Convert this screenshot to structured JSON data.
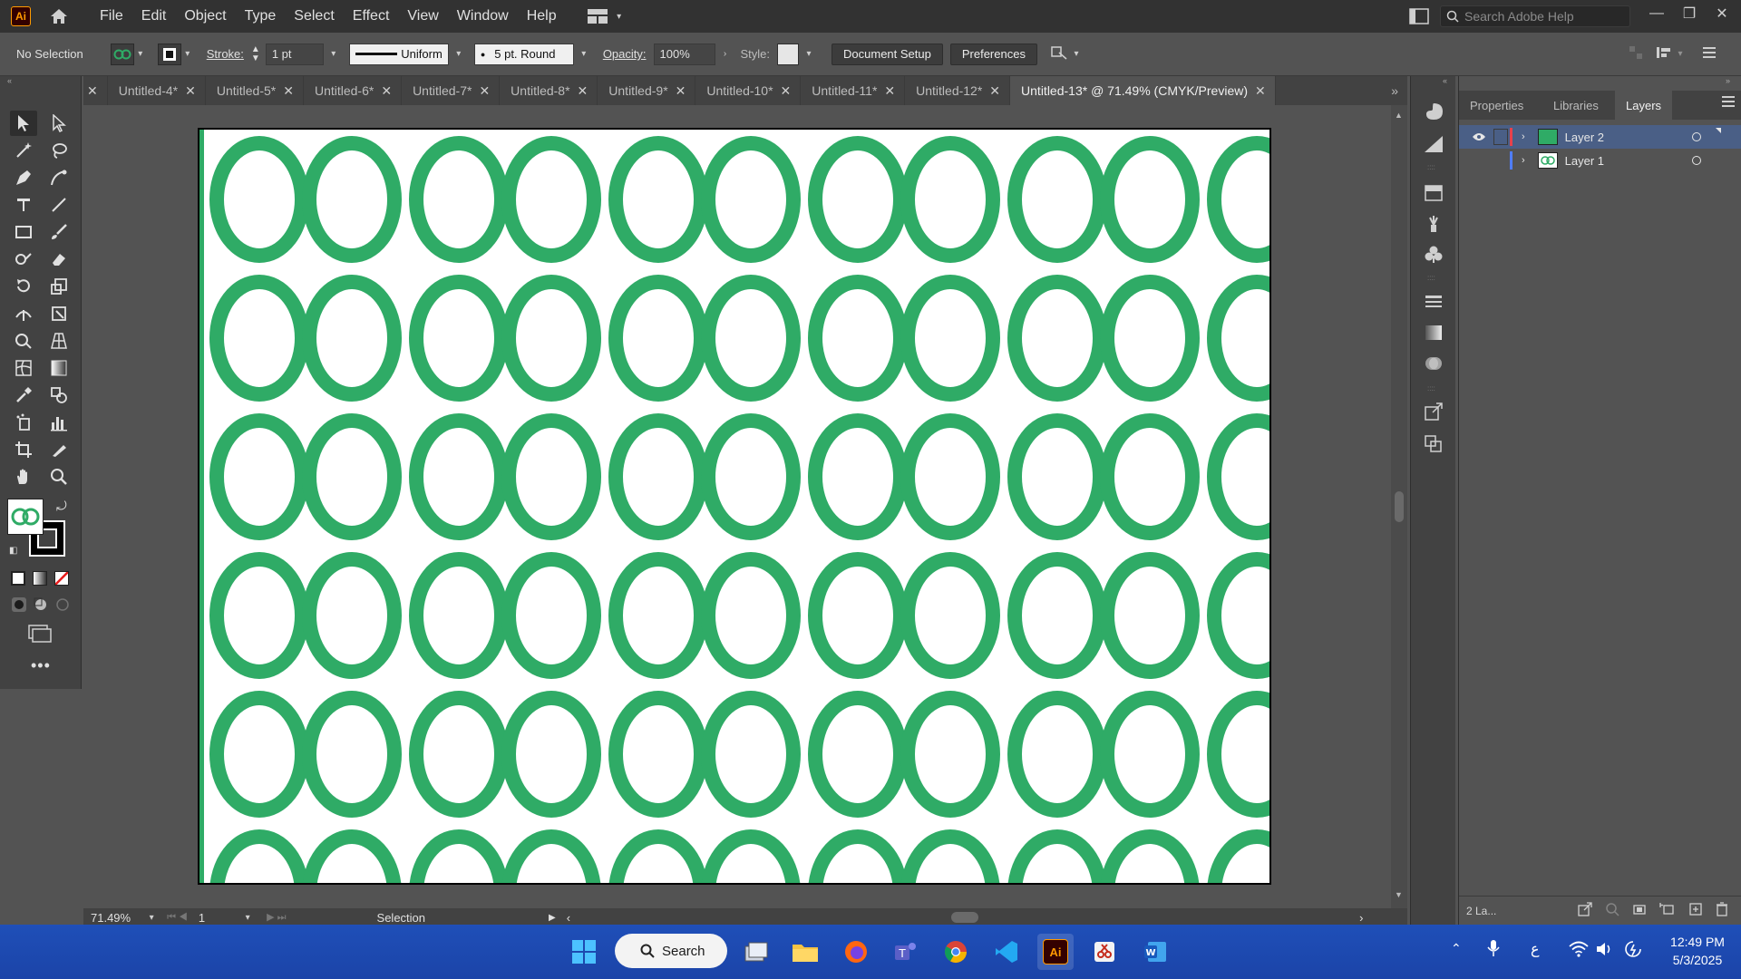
{
  "app": {
    "logo_text": "Ai",
    "menu": [
      "File",
      "Edit",
      "Object",
      "Type",
      "Select",
      "Effect",
      "View",
      "Window",
      "Help"
    ],
    "search_placeholder": "Search Adobe Help"
  },
  "control_bar": {
    "selection_label": "No Selection",
    "stroke_label": "Stroke:",
    "stroke_value": "1 pt",
    "stroke_profile": "Uniform",
    "brush": "5 pt. Round",
    "opacity_label": "Opacity:",
    "opacity_value": "100%",
    "style_label": "Style:",
    "document_setup": "Document Setup",
    "preferences": "Preferences"
  },
  "tabs": [
    {
      "label": "Untitled-4*",
      "active": false
    },
    {
      "label": "Untitled-5*",
      "active": false
    },
    {
      "label": "Untitled-6*",
      "active": false
    },
    {
      "label": "Untitled-7*",
      "active": false
    },
    {
      "label": "Untitled-8*",
      "active": false
    },
    {
      "label": "Untitled-9*",
      "active": false
    },
    {
      "label": "Untitled-10*",
      "active": false
    },
    {
      "label": "Untitled-11*",
      "active": false
    },
    {
      "label": "Untitled-12*",
      "active": false
    },
    {
      "label": "Untitled-13* @ 71.49% (CMYK/Preview)",
      "active": true
    }
  ],
  "status": {
    "zoom": "71.49%",
    "artboard_number": "1",
    "tool_name": "Selection"
  },
  "panel": {
    "tabs": [
      "Properties",
      "Libraries",
      "Layers"
    ],
    "active_tab": "Layers",
    "layers": [
      {
        "name": "Layer 2",
        "color": "#e8414b",
        "selected": true
      },
      {
        "name": "Layer 1",
        "color": "#4f7dff",
        "selected": false
      }
    ],
    "layer_count": "2 La..."
  },
  "taskbar": {
    "search_label": "Search",
    "time": "12:49 PM",
    "date": "5/3/2025",
    "lang": "ع"
  },
  "colors": {
    "pattern_green": "#2fab66",
    "app_bg": "#535353",
    "panel_dark": "#424242",
    "taskbar": "#1f4fb8"
  }
}
